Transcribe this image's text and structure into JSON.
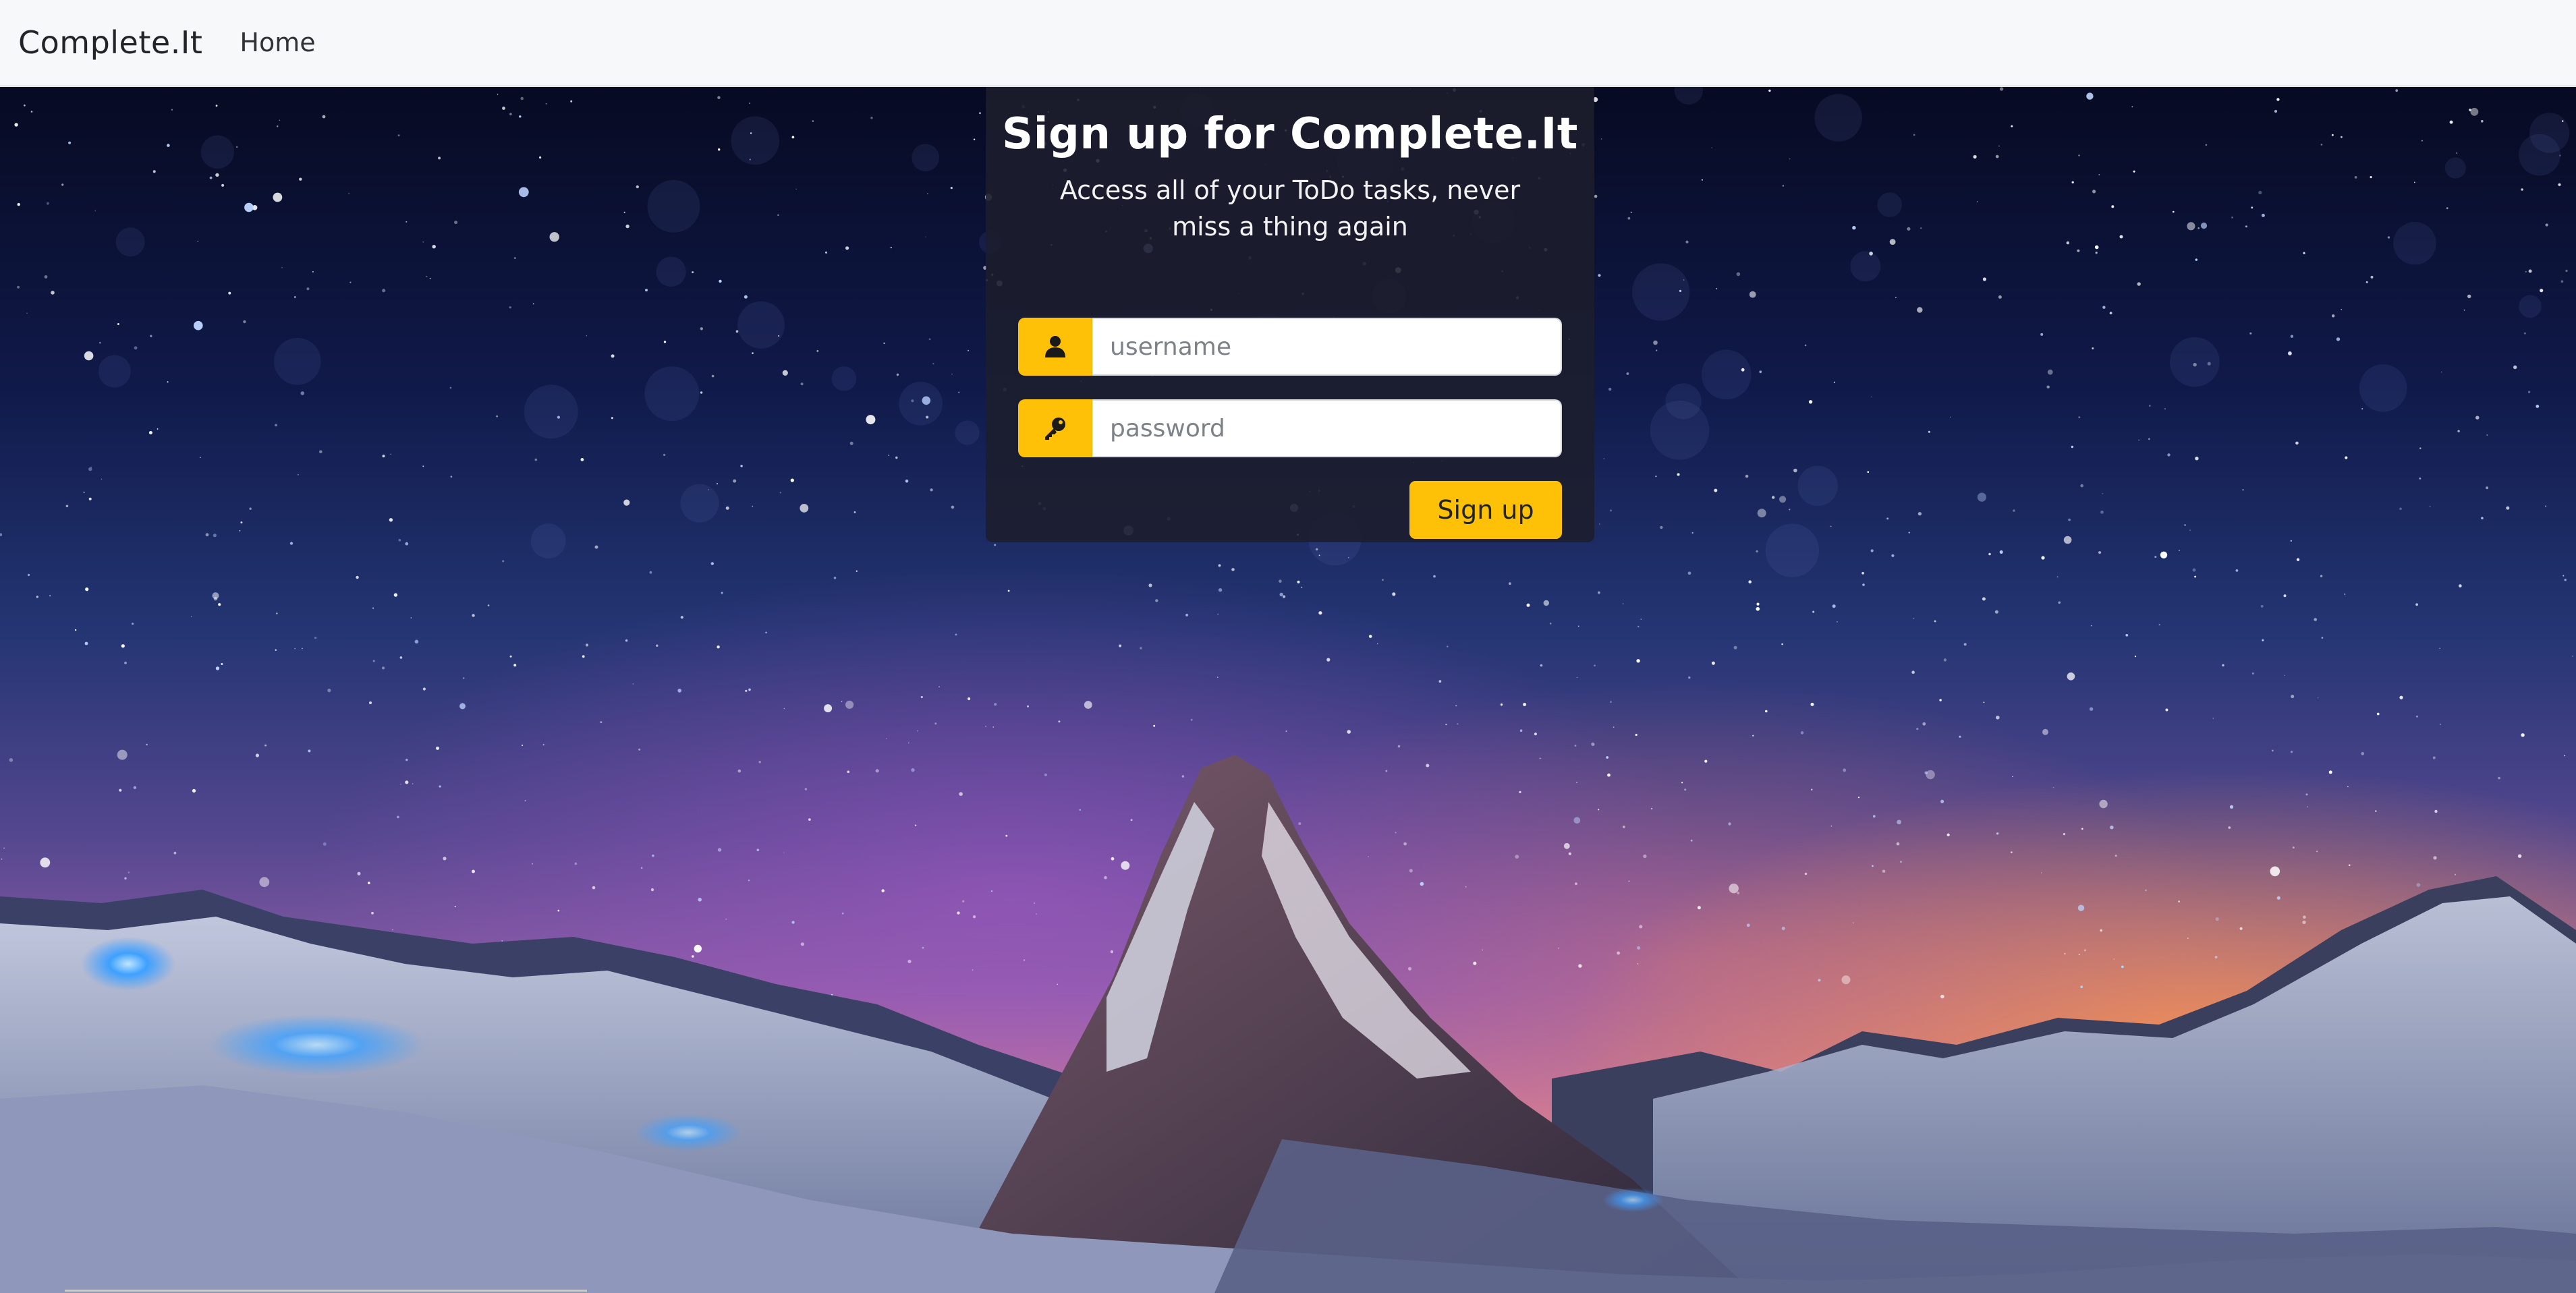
{
  "navbar": {
    "brand": "Complete.It",
    "links": [
      {
        "label": "Home"
      }
    ]
  },
  "signup": {
    "title": "Sign up for Complete.It",
    "subtitle": "Access all of your ToDo tasks, never miss a thing again",
    "username": {
      "placeholder": "username",
      "value": "",
      "icon": "user-icon"
    },
    "password": {
      "placeholder": "password",
      "value": "",
      "icon": "key-icon"
    },
    "submit_label": "Sign up"
  },
  "colors": {
    "accent": "#ffc107",
    "navbar_bg": "#f7f8fa",
    "card_bg": "#1c1e2c"
  }
}
